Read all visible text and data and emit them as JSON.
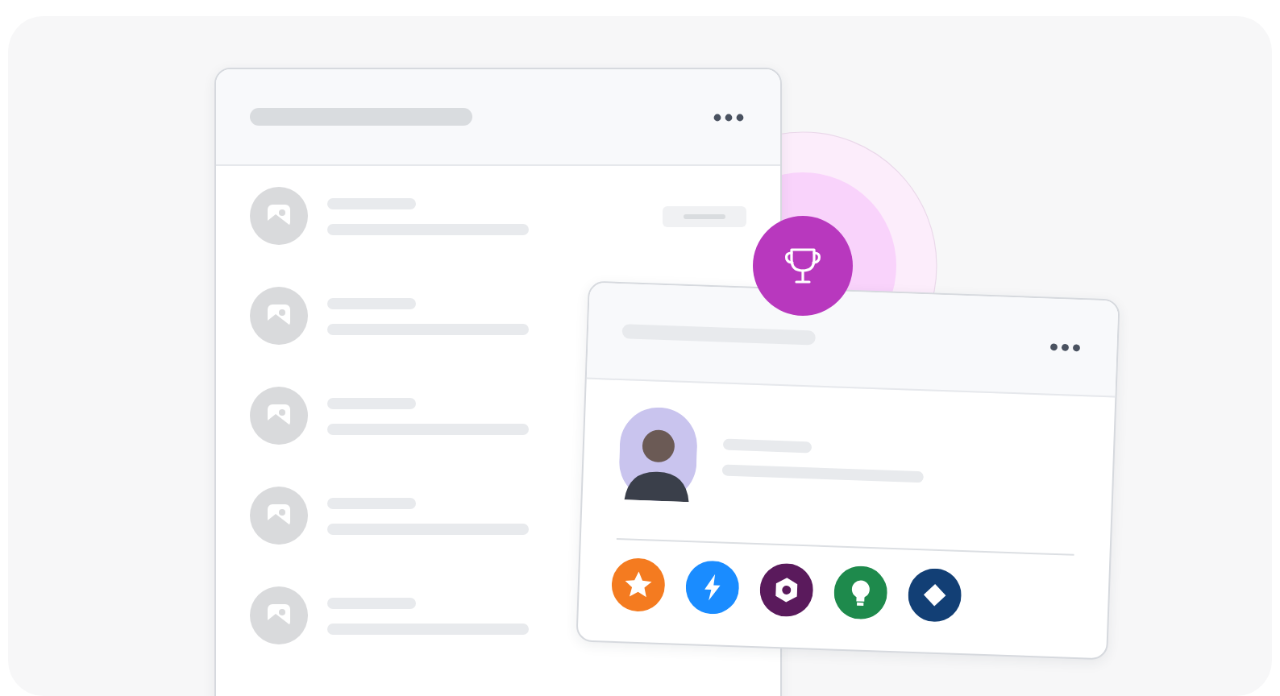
{
  "list_rows": [
    {
      "tag": true
    },
    {
      "tag": false
    },
    {
      "tag": false
    },
    {
      "tag": false
    },
    {
      "tag": false
    }
  ],
  "badges": [
    {
      "kind": "star",
      "color": "#f47b20"
    },
    {
      "kind": "bolt",
      "color": "#1a8cff"
    },
    {
      "kind": "hexagon",
      "color": "#5a1a5c"
    },
    {
      "kind": "bulb",
      "color": "#1e8a4c"
    },
    {
      "kind": "diamond",
      "color": "#123f75"
    }
  ]
}
